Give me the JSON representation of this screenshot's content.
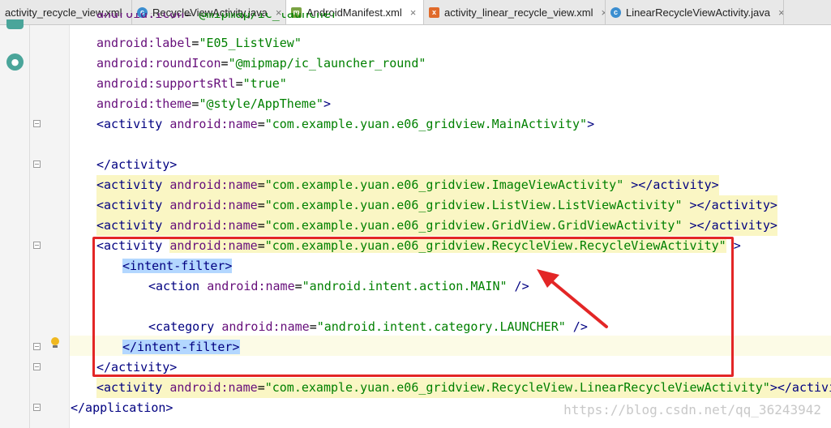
{
  "tabs": [
    {
      "label": "activity_recycle_view.xml",
      "icon": "xml-file-icon",
      "active": false
    },
    {
      "label": "RecycleViewActivity.java",
      "icon": "java-class-icon",
      "active": false
    },
    {
      "label": "AndroidManifest.xml",
      "icon": "manifest-file-icon",
      "active": true
    },
    {
      "label": "activity_linear_recycle_view.xml",
      "icon": "layout-xml-icon",
      "active": false
    },
    {
      "label": "LinearRecycleViewActivity.java",
      "icon": "java-class-icon",
      "active": false
    }
  ],
  "tab_close_glyph": "×",
  "code": {
    "l1": {
      "attr": "android:icon",
      "eq": "=",
      "val": "\"@mipmap/ic_launcher\""
    },
    "l2": {
      "attr": "android:label",
      "eq": "=",
      "val": "\"E05_ListView\""
    },
    "l3": {
      "attr": "android:roundIcon",
      "eq": "=",
      "val": "\"@mipmap/ic_launcher_round\""
    },
    "l4": {
      "attr": "android:supportsRtl",
      "eq": "=",
      "val": "\"true\""
    },
    "l5": {
      "attr": "android:theme",
      "eq": "=",
      "val": "\"@style/AppTheme\"",
      "end": ">"
    },
    "l6": {
      "open": "<activity ",
      "attr": "android:name",
      "eq": "=",
      "val": "\"com.example.yuan.e06_gridview.MainActivity\"",
      "end": ">"
    },
    "l8": {
      "text": "</activity>"
    },
    "l9": {
      "open": "<activity ",
      "attr": "android:name",
      "eq": "=",
      "val": "\"com.example.yuan.e06_gridview.ImageViewActivity\"",
      "end": " ></activity>"
    },
    "l10": {
      "open": "<activity ",
      "attr": "android:name",
      "eq": "=",
      "val": "\"com.example.yuan.e06_gridview.ListView.ListViewActivity\"",
      "end": " ></activity>"
    },
    "l11": {
      "open": "<activity ",
      "attr": "android:name",
      "eq": "=",
      "val": "\"com.example.yuan.e06_gridview.GridView.GridViewActivity\"",
      "end": " ></activity>"
    },
    "l12": {
      "open": "<activity ",
      "attr": "android:name",
      "eq": "=",
      "val": "\"com.example.yuan.e06_gridview.RecycleView.RecycleViewActivity\"",
      "end": " >"
    },
    "l13": {
      "text": "<intent-filter>"
    },
    "l14": {
      "open": "<action ",
      "attr": "android:name",
      "eq": "=",
      "val": "\"android.intent.action.MAIN\"",
      "end": " />"
    },
    "l16": {
      "open": "<category ",
      "attr": "android:name",
      "eq": "=",
      "val": "\"android.intent.category.LAUNCHER\"",
      "end": " />"
    },
    "l17": {
      "text": "</intent-filter>"
    },
    "l18": {
      "text": "</activity>"
    },
    "l19": {
      "open": "<activity ",
      "attr": "android:name",
      "eq": "=",
      "val": "\"com.example.yuan.e06_gridview.RecycleView.LinearRecycleViewActivity\"",
      "end": "></activi"
    },
    "l20": {
      "text": "</application>"
    }
  },
  "watermark": "https://blog.csdn.net/qq_36243942",
  "colors": {
    "tag": "#000080",
    "attribute": "#660e7a",
    "value": "#008000",
    "annotation": "#e32626",
    "selection": "#b3d7ff"
  }
}
